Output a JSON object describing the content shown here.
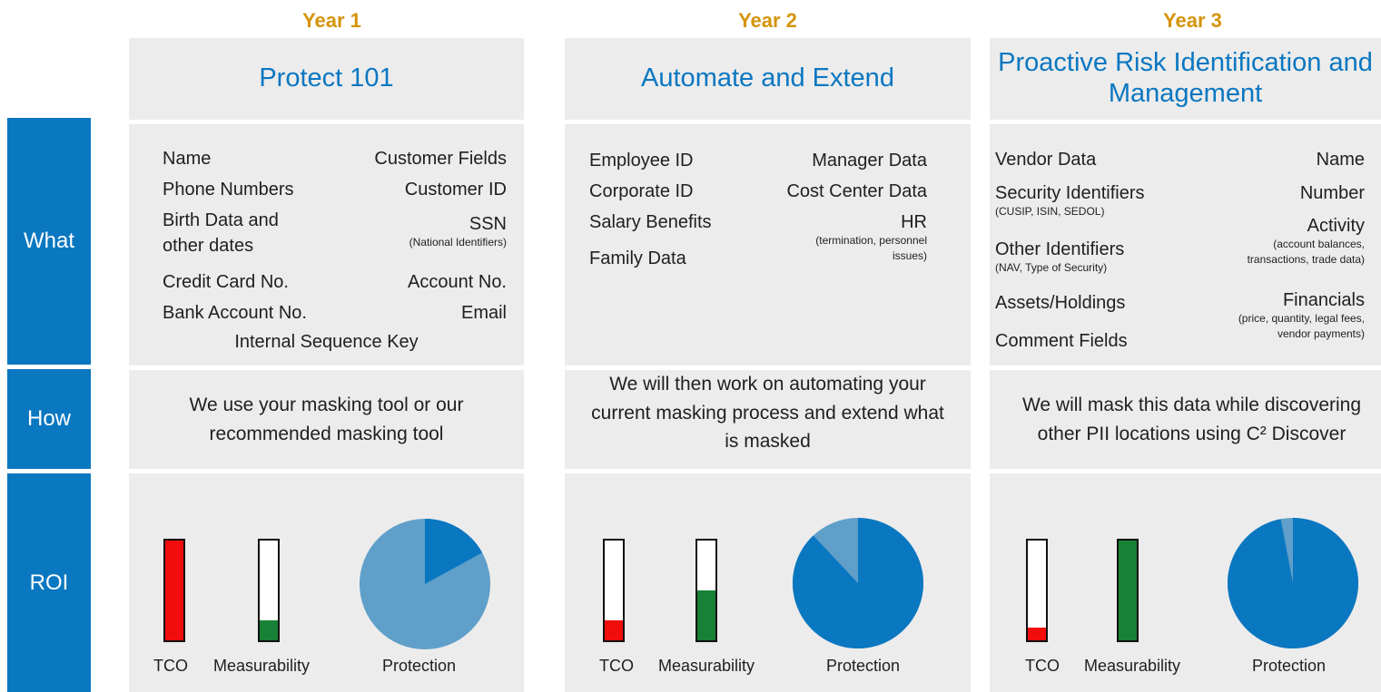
{
  "side_labels": {
    "what": "What",
    "how": "How",
    "roi": "ROI"
  },
  "years": [
    {
      "label": "Year 1",
      "title": "Protect 101",
      "what": {
        "left": [
          "Name",
          "Phone Numbers",
          "Birth Data and",
          "other dates",
          "Credit Card No.",
          "Bank Account No."
        ],
        "right": [
          "Customer Fields",
          "Customer ID",
          "SSN",
          "Account No.",
          "Email"
        ],
        "right_notes": [
          "(National Identifiers)"
        ],
        "center": "Internal Sequence Key"
      },
      "how": "We use your masking tool or our recommended masking tool",
      "roi": {
        "tco": 1.0,
        "measurability": 0.2,
        "protection": 0.17
      }
    },
    {
      "label": "Year 2",
      "title": "Automate and Extend",
      "what": {
        "left": [
          "Employee ID",
          "Corporate ID",
          "Salary Benefits",
          "Family Data"
        ],
        "right": [
          "Manager Data",
          "Cost Center Data",
          "HR"
        ],
        "right_notes": [
          "(termination, personnel",
          "issues)"
        ]
      },
      "how": "We will then work on automating your current masking process and extend what is masked",
      "roi": {
        "tco": 0.2,
        "measurability": 0.5,
        "protection": 0.88
      }
    },
    {
      "label": "Year 3",
      "title": "Proactive Risk Identification and Management",
      "what": {
        "left": [
          "Vendor Data",
          "Security Identifiers",
          "Other Identifiers",
          "Assets/Holdings",
          "Comment Fields"
        ],
        "left_notes": [
          "(CUSIP, ISIN, SEDOL)",
          "(NAV, Type of Security)"
        ],
        "right": [
          "Name",
          "Number",
          "Activity",
          "Financials"
        ],
        "right_notes": [
          "(account balances,",
          "transactions, trade data)",
          "(price, quantity, legal fees,",
          "vendor payments)"
        ]
      },
      "how": "We will mask this data while discovering other PII locations using C² Discover",
      "roi": {
        "tco": 0.13,
        "measurability": 1.0,
        "protection": 0.97
      }
    }
  ],
  "roi_labels": {
    "tco": "TCO",
    "measurability": "Measurability",
    "protection": "Protection"
  },
  "colors": {
    "accent_blue": "#0a77c1",
    "pie_light": "#5f9fc9",
    "year_gold": "#d4940c",
    "bar_red": "#f20d0d",
    "bar_green": "#178237",
    "panel_bg": "#ececec"
  }
}
